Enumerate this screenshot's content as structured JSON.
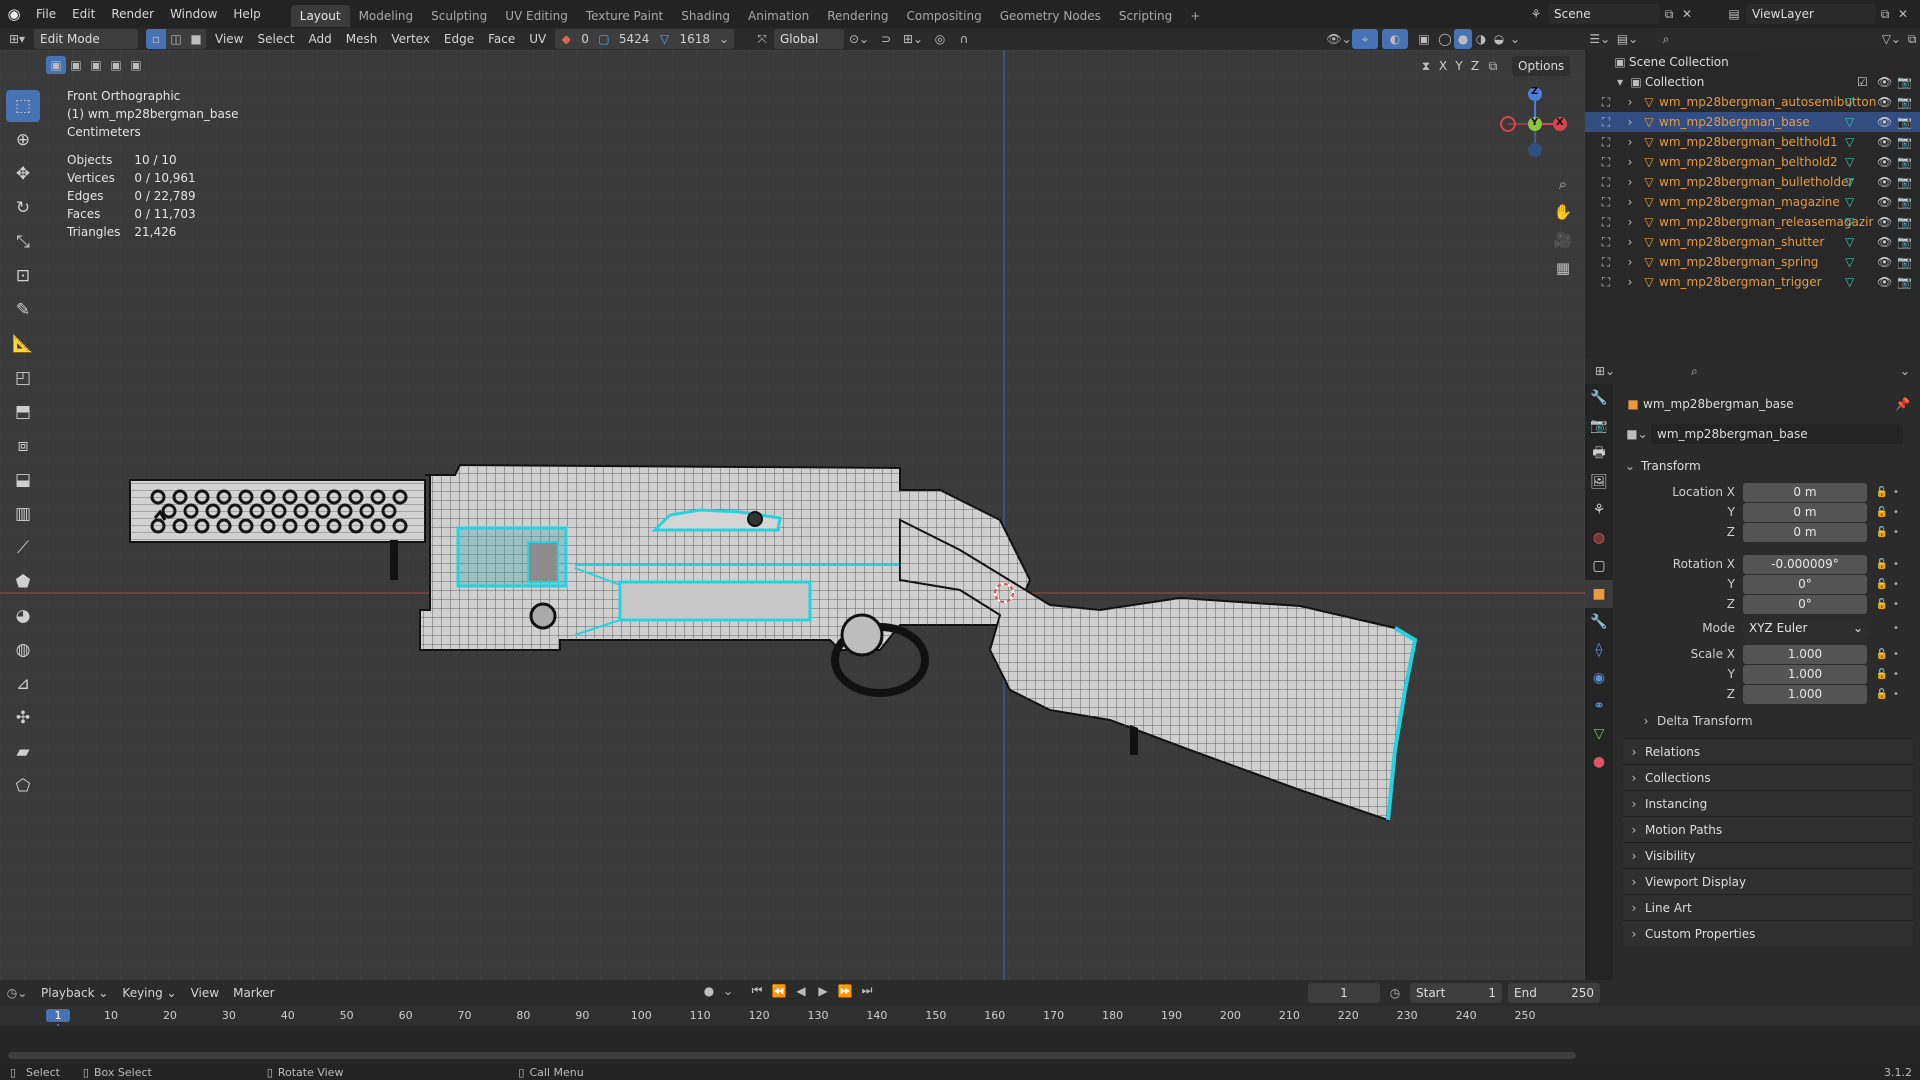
{
  "menubar": {
    "items": [
      "File",
      "Edit",
      "Render",
      "Window",
      "Help"
    ],
    "workspaces": [
      "Layout",
      "Modeling",
      "Sculpting",
      "UV Editing",
      "Texture Paint",
      "Shading",
      "Animation",
      "Rendering",
      "Compositing",
      "Geometry Nodes",
      "Scripting"
    ],
    "active_workspace": "Layout",
    "add_tab": "+",
    "scene_label": "Scene",
    "viewlayer_label": "ViewLayer"
  },
  "viewport_header": {
    "mode": "Edit Mode",
    "menus": [
      "View",
      "Select",
      "Add",
      "Mesh",
      "Vertex",
      "Edge",
      "Face",
      "UV"
    ],
    "counters": [
      "0",
      "5424",
      "1618"
    ],
    "transform_orientation": "Global",
    "options_label": "Options",
    "axes": [
      "X",
      "Y",
      "Z"
    ]
  },
  "overlay": {
    "view_name": "Front Orthographic",
    "object_name": "(1) wm_mp28bergman_base",
    "units": "Centimeters",
    "stats": [
      {
        "label": "Objects",
        "value": "10 / 10"
      },
      {
        "label": "Vertices",
        "value": "0 / 10,961"
      },
      {
        "label": "Edges",
        "value": "0 / 22,789"
      },
      {
        "label": "Faces",
        "value": "0 / 11,703"
      },
      {
        "label": "Triangles",
        "value": "21,426"
      }
    ]
  },
  "gizmo": {
    "z": "Z",
    "y": "Y",
    "x": "X"
  },
  "outliner": {
    "root": "Scene Collection",
    "collection": "Collection",
    "objects": [
      {
        "name": "wm_mp28bergman_autosemibutton",
        "selected": false
      },
      {
        "name": "wm_mp28bergman_base",
        "selected": true
      },
      {
        "name": "wm_mp28bergman_belthold1",
        "selected": false
      },
      {
        "name": "wm_mp28bergman_belthold2",
        "selected": false
      },
      {
        "name": "wm_mp28bergman_bulletholder",
        "selected": false
      },
      {
        "name": "wm_mp28bergman_magazine",
        "selected": false
      },
      {
        "name": "wm_mp28bergman_releasemagazir",
        "selected": false
      },
      {
        "name": "wm_mp28bergman_shutter",
        "selected": false
      },
      {
        "name": "wm_mp28bergman_spring",
        "selected": false
      },
      {
        "name": "wm_mp28bergman_trigger",
        "selected": false
      }
    ]
  },
  "properties": {
    "object_title": "wm_mp28bergman_base",
    "object_name_field": "wm_mp28bergman_base",
    "transform_label": "Transform",
    "location": [
      {
        "label": "Location X",
        "value": "0 m"
      },
      {
        "label": "Y",
        "value": "0 m"
      },
      {
        "label": "Z",
        "value": "0 m"
      }
    ],
    "rotation": [
      {
        "label": "Rotation X",
        "value": "-0.000009°"
      },
      {
        "label": "Y",
        "value": "0°"
      },
      {
        "label": "Z",
        "value": "0°"
      }
    ],
    "mode_label": "Mode",
    "mode_value": "XYZ Euler",
    "scale": [
      {
        "label": "Scale X",
        "value": "1.000"
      },
      {
        "label": "Y",
        "value": "1.000"
      },
      {
        "label": "Z",
        "value": "1.000"
      }
    ],
    "delta_transform": "Delta Transform",
    "subpanels": [
      "Relations",
      "Collections",
      "Instancing",
      "Motion Paths",
      "Visibility",
      "Viewport Display",
      "Line Art",
      "Custom Properties"
    ]
  },
  "timeline": {
    "menus": [
      "Playback",
      "Keying",
      "View",
      "Marker"
    ],
    "current_frame": "1",
    "start_label": "Start",
    "start_value": "1",
    "end_label": "End",
    "end_value": "250",
    "ruler": [
      "1",
      "10",
      "20",
      "30",
      "40",
      "50",
      "60",
      "70",
      "80",
      "90",
      "100",
      "110",
      "120",
      "130",
      "140",
      "150",
      "160",
      "170",
      "180",
      "190",
      "200",
      "210",
      "220",
      "230",
      "240",
      "250"
    ]
  },
  "statusbar": {
    "items": [
      "Select",
      "Box Select",
      "Rotate View",
      "Call Menu"
    ],
    "version": "3.1.2"
  },
  "colors": {
    "accent": "#4772b3",
    "selected_mesh": "#22c7d6",
    "object_orange": "#e89a3c"
  }
}
